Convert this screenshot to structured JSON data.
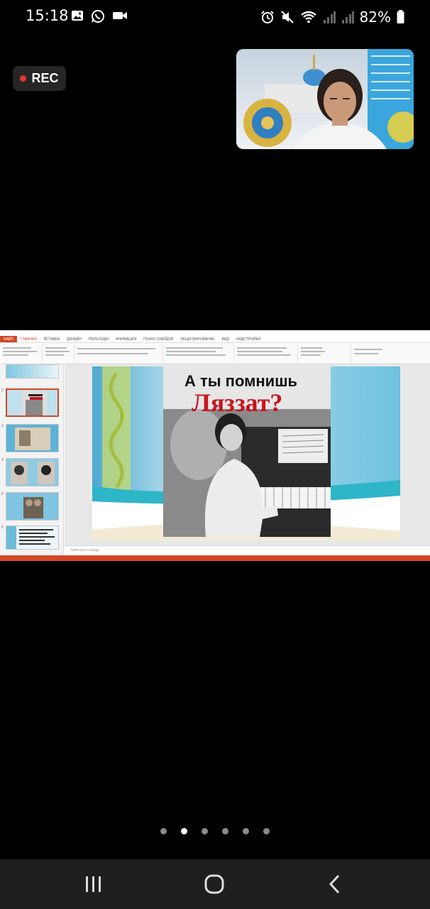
{
  "status_bar": {
    "time": "15:18",
    "battery": "82%",
    "icons_left": [
      "gallery-icon",
      "whatsapp-icon",
      "video-camera-icon"
    ],
    "icons_right": [
      "alarm-icon",
      "mute-icon",
      "wifi-icon",
      "signal-icon",
      "signal-icon",
      "battery-icon"
    ]
  },
  "recording": {
    "label": "REC",
    "dot_color": "#e53935"
  },
  "shared_screen": {
    "app": "PowerPoint",
    "ribbon_tabs": [
      "ФАЙЛ",
      "ГЛАВНАЯ",
      "ВСТАВКА",
      "ДИЗАЙН",
      "ПЕРЕХОДЫ",
      "АНИМАЦИЯ",
      "ПОКАЗ СЛАЙДОВ",
      "РЕЦЕНЗИРОВАНИЕ",
      "ВИД",
      "НАДСТРОЙКИ"
    ],
    "accent_color": "#d24726",
    "notes_placeholder": "Заметки к слайду",
    "slide": {
      "title_line1": "А ты помнишь",
      "title_line2": "Ляззат?"
    },
    "thumbnails": [
      {
        "number": "1"
      },
      {
        "number": "2"
      },
      {
        "number": "3"
      },
      {
        "number": "4"
      },
      {
        "number": "5"
      },
      {
        "number": "6"
      }
    ]
  },
  "pager": {
    "count": 6,
    "active_index": 1
  },
  "nav_bar": {
    "buttons": [
      "recent-apps-icon",
      "home-icon",
      "back-icon"
    ]
  }
}
